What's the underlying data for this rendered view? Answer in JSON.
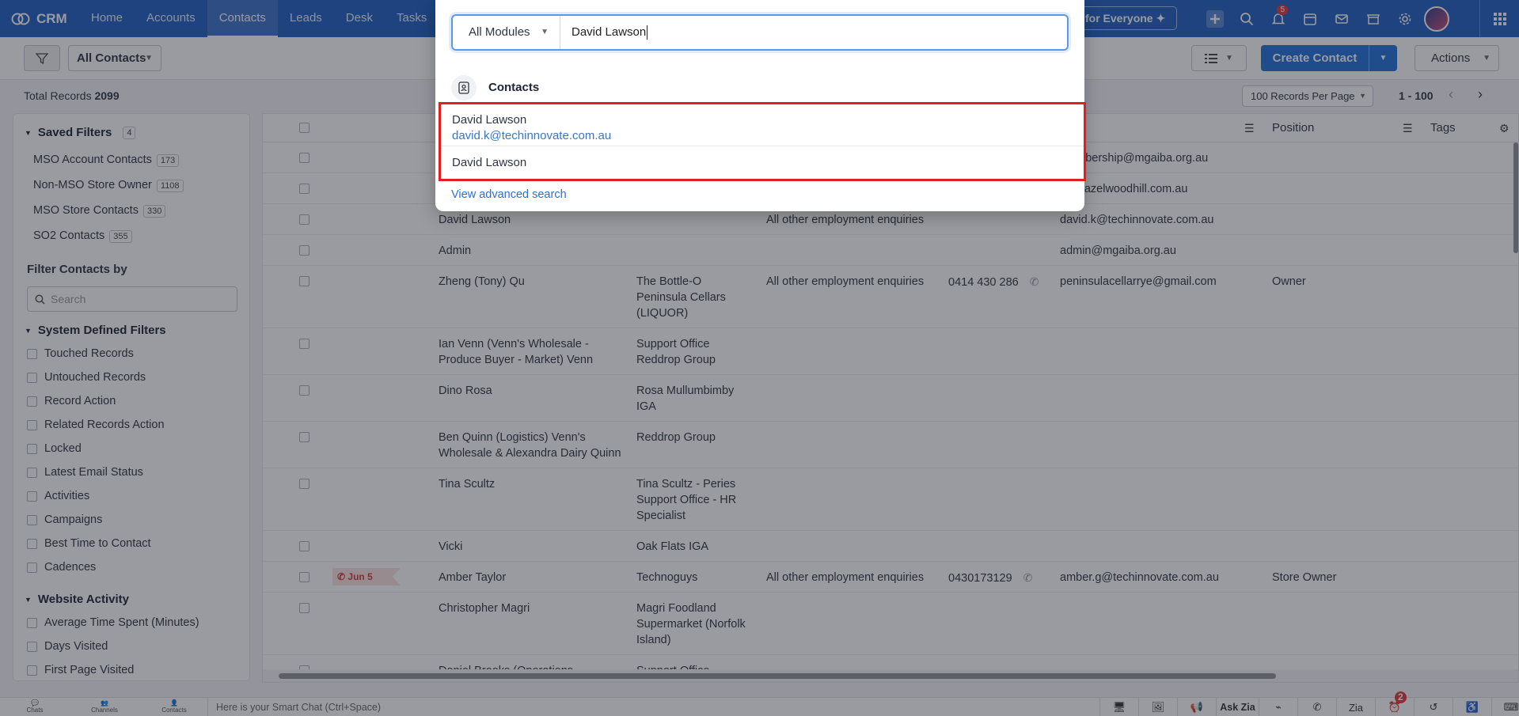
{
  "app": {
    "logo_text": "CRM",
    "nav_tabs": [
      "Home",
      "Accounts",
      "Contacts",
      "Leads",
      "Desk",
      "Tasks"
    ],
    "promo_label": "for Everyone",
    "notification_count": "5"
  },
  "toolbar": {
    "view_label": "All Contacts",
    "create_label": "Create Contact",
    "actions_label": "Actions"
  },
  "records": {
    "total_label": "Total Records",
    "total_count": "2099",
    "per_page": "100 Records Per Page",
    "range": "1 - 100"
  },
  "sidebar": {
    "saved_filters_title": "Saved Filters",
    "saved_filters_count": "4",
    "saved_filters": [
      {
        "label": "MSO Account Contacts",
        "count": "173"
      },
      {
        "label": "Non-MSO Store Owner",
        "count": "1108"
      },
      {
        "label": "MSO Store Contacts",
        "count": "330"
      },
      {
        "label": "SO2 Contacts",
        "count": "355"
      }
    ],
    "filter_by_title": "Filter Contacts by",
    "search_placeholder": "Search",
    "system_filters_title": "System Defined Filters",
    "system_filters": [
      "Touched Records",
      "Untouched Records",
      "Record Action",
      "Related Records Action",
      "Locked",
      "Latest Email Status",
      "Activities",
      "Campaigns",
      "Best Time to Contact",
      "Cadences"
    ],
    "website_activity_title": "Website Activity",
    "website_filters": [
      "Average Time Spent (Minutes)",
      "Days Visited",
      "First Page Visited"
    ]
  },
  "table": {
    "visible_headers": {
      "position": "Position",
      "tags": "Tags"
    },
    "rows": [
      {
        "tag": "",
        "name": "",
        "account": "",
        "type": "",
        "phone": "",
        "email": "membership@mgaiba.org.au",
        "position": ""
      },
      {
        "tag": "",
        "name": "",
        "account": "",
        "type": "",
        "phone": "",
        "email": "e@hazelwoodhill.com.au",
        "position": ""
      },
      {
        "tag": "",
        "name": "David Lawson",
        "account": "",
        "type": "All other employment enquiries",
        "phone": "",
        "email": "david.k@techinnovate.com.au",
        "position": ""
      },
      {
        "tag": "",
        "name": "Admin",
        "account": "",
        "type": "",
        "phone": "",
        "email": "admin@mgaiba.org.au",
        "position": ""
      },
      {
        "tag": "",
        "name": "Zheng (Tony) Qu",
        "account": "The Bottle-O Peninsula Cellars (LIQUOR)",
        "type": "All other employment enquiries",
        "phone": "0414 430 286",
        "email": "peninsulacellarrye@gmail.com",
        "position": "Owner"
      },
      {
        "tag": "",
        "name": "Ian Venn (Venn's Wholesale - Produce Buyer - Market) Venn",
        "account": "Support Office Reddrop Group",
        "type": "",
        "phone": "",
        "email": "",
        "position": ""
      },
      {
        "tag": "",
        "name": "Dino Rosa",
        "account": "Rosa Mullumbimby IGA",
        "type": "",
        "phone": "",
        "email": "",
        "position": ""
      },
      {
        "tag": "",
        "name": "Ben Quinn (Logistics) Venn's Wholesale & Alexandra Dairy Quinn",
        "account": "Reddrop Group",
        "type": "",
        "phone": "",
        "email": "",
        "position": ""
      },
      {
        "tag": "",
        "name": "Tina Scultz",
        "account": "Tina Scultz - Peries Support Office - HR Specialist",
        "type": "",
        "phone": "",
        "email": "",
        "position": ""
      },
      {
        "tag": "",
        "name": "Vicki",
        "account": "Oak Flats IGA",
        "type": "",
        "phone": "",
        "email": "",
        "position": ""
      },
      {
        "tag": "Jun 5",
        "name": "Amber Taylor",
        "account": "Technoguys",
        "type": "All other employment enquiries",
        "phone": "0430173129",
        "email": "amber.g@techinnovate.com.au",
        "position": "Store Owner"
      },
      {
        "tag": "",
        "name": "Christopher Magri",
        "account": "Magri Foodland Supermarket (Norfolk Island)",
        "type": "",
        "phone": "",
        "email": "",
        "position": ""
      },
      {
        "tag": "",
        "name": "Daniel Brooks (Operations",
        "account": "Support Office",
        "type": "",
        "phone": "",
        "email": "",
        "position": ""
      }
    ]
  },
  "search": {
    "module": "All Modules",
    "query": "David Lawson",
    "category": "Contacts",
    "results": [
      {
        "name": "David Lawson",
        "email": "david.k@techinnovate.com.au"
      },
      {
        "name": "David Lawson",
        "email": ""
      }
    ],
    "advanced_link": "View advanced search"
  },
  "bottom_bar": {
    "buttons": [
      "Chats",
      "Channels",
      "Contacts"
    ],
    "smart_chat_placeholder": "Here is your Smart Chat (Ctrl+Space)",
    "ask_zia": "Ask Zia",
    "zia_label": "Zia",
    "reminder_count": "2"
  }
}
